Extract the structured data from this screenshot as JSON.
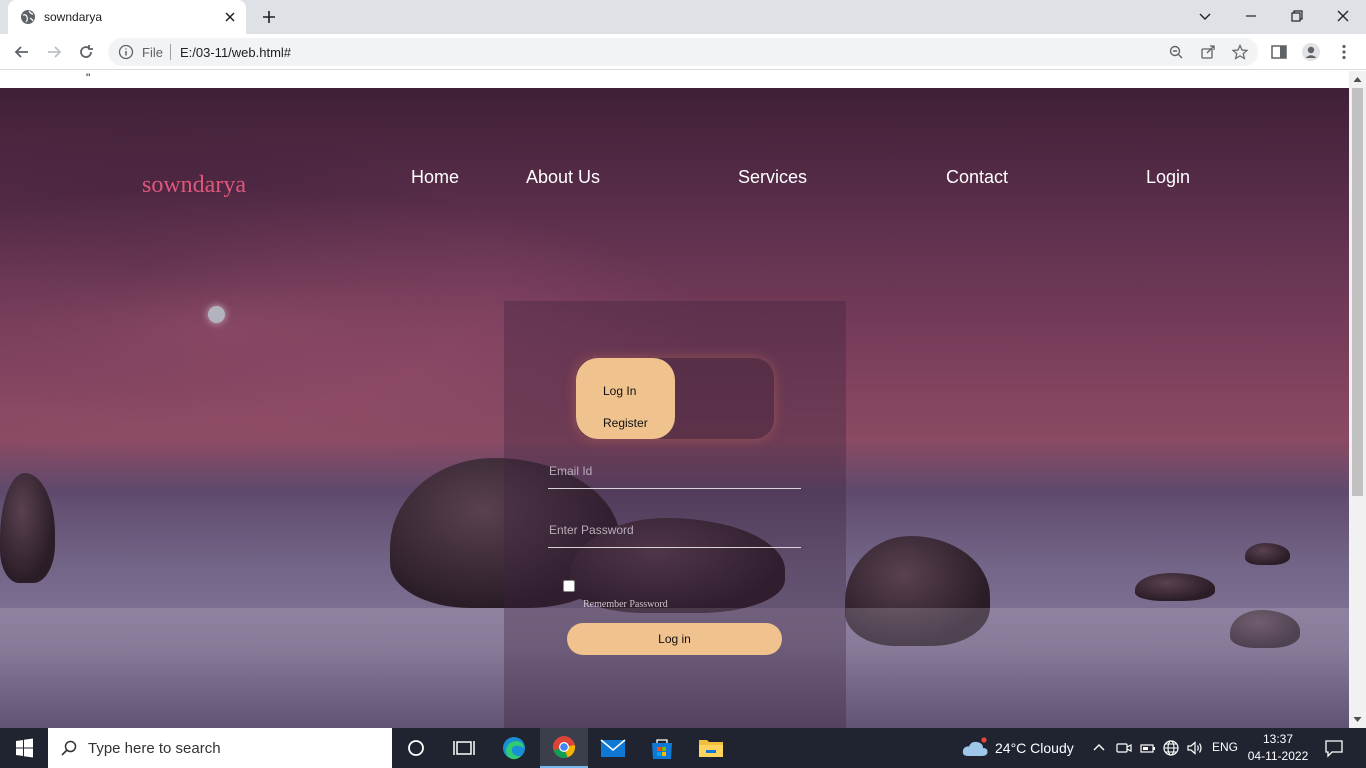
{
  "browser": {
    "tab_title": "sowndarya",
    "omnibox_scheme": "File",
    "url": "E:/03-11/web.html#"
  },
  "page": {
    "stray_text": "\"",
    "brand": "sowndarya",
    "nav": [
      "Home",
      "About Us",
      "Services",
      "Contact",
      "Login"
    ],
    "toggle": {
      "login_label": "Log In",
      "register_label": "Register"
    },
    "form": {
      "email_placeholder": "Email Id",
      "password_placeholder": "Enter Password",
      "remember_label": "Remember Password",
      "submit_label": "Log in"
    }
  },
  "taskbar": {
    "search_placeholder": "Type here to search",
    "weather": "24°C  Cloudy",
    "language": "ENG",
    "time": "13:37",
    "date": "04-11-2022"
  },
  "colors": {
    "brand": "#e0577c",
    "accent": "#f0c28d"
  }
}
